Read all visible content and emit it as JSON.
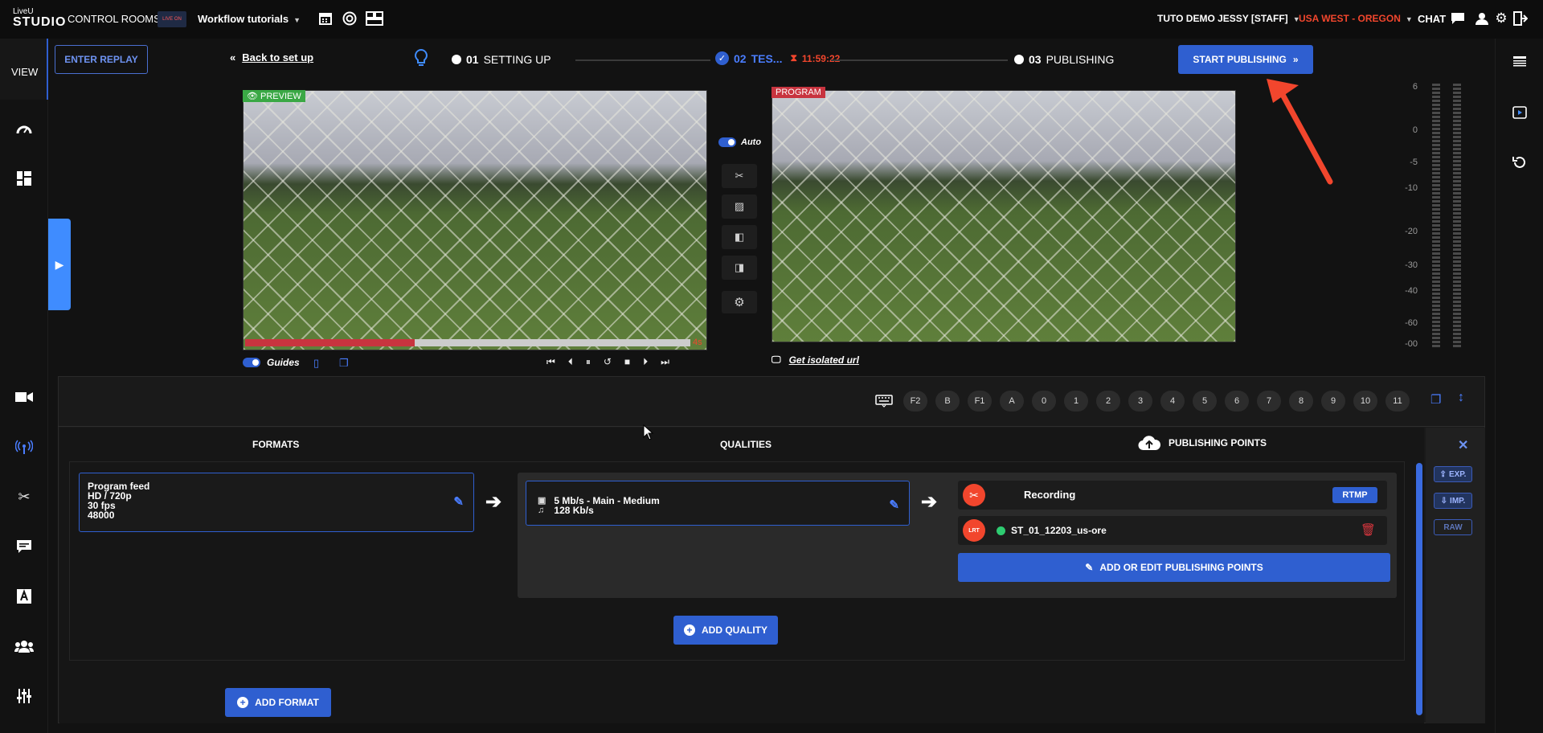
{
  "header": {
    "logo_top": "LiveU",
    "logo_main": "STUDIO",
    "control_rooms": "CONTROL ROOMS",
    "project_thumb": "LIVE ON",
    "project_name": "Workflow tutorials",
    "user": "TUTO DEMO JESSY [STAFF]",
    "region": "USA WEST - OREGON",
    "chat": "CHAT"
  },
  "sidebar": {
    "view_label": "VIEW",
    "items": [
      "dashboard-icon",
      "layout-icon",
      "camera-icon",
      "broadcast-icon",
      "tools-icon",
      "subtitle-icon",
      "text-icon",
      "users-icon",
      "sliders-icon"
    ]
  },
  "steps": {
    "enter_replay": "ENTER REPLAY",
    "back": "Back to set up",
    "step1_num": "01",
    "step1_label": "SETTING UP",
    "step2_num": "02",
    "step2_label": "TES...",
    "timer": "11:59:22",
    "step3_num": "03",
    "step3_label": "PUBLISHING",
    "start_publishing": "START PUBLISHING"
  },
  "preview": {
    "tag": "PREVIEW",
    "buffer": "4s",
    "progress": 0.38,
    "guides": "Guides"
  },
  "program": {
    "tag": "PROGRAM",
    "isolated_url": "Get isolated url"
  },
  "auto_label": "Auto",
  "audio_meter": {
    "labels": [
      "6",
      "0",
      "-5",
      "-10",
      "-20",
      "-30",
      "-40",
      "-60",
      "-00"
    ]
  },
  "hotkeys": [
    "F2",
    "B",
    "F1",
    "A",
    "0",
    "1",
    "2",
    "3",
    "4",
    "5",
    "6",
    "7",
    "8",
    "9",
    "10",
    "11"
  ],
  "publishing": {
    "formats_header": "FORMATS",
    "qualities_header": "QUALITIES",
    "points_header": "PUBLISHING POINTS",
    "format_card": [
      "Program feed",
      "HD / 720p",
      "30 fps",
      "48000"
    ],
    "quality_video": "5 Mb/s  -  Main  -  Medium",
    "quality_audio": "128 Kb/s",
    "point1_name": "Recording",
    "point1_badge": "RTMP",
    "point2_icon": "LRT",
    "point2_name": "ST_01_12203_us-ore",
    "add_edit_points": "ADD OR EDIT PUBLISHING POINTS",
    "add_quality": "ADD QUALITY",
    "add_format": "ADD FORMAT",
    "exp": "EXP.",
    "imp": "IMP.",
    "raw": "RAW"
  },
  "colors": {
    "accent": "#2f5fd0",
    "alert": "#f2462d",
    "preview_tag": "#3aa845",
    "program_tag": "#c8343f",
    "live_dot": "#2ecc71"
  }
}
